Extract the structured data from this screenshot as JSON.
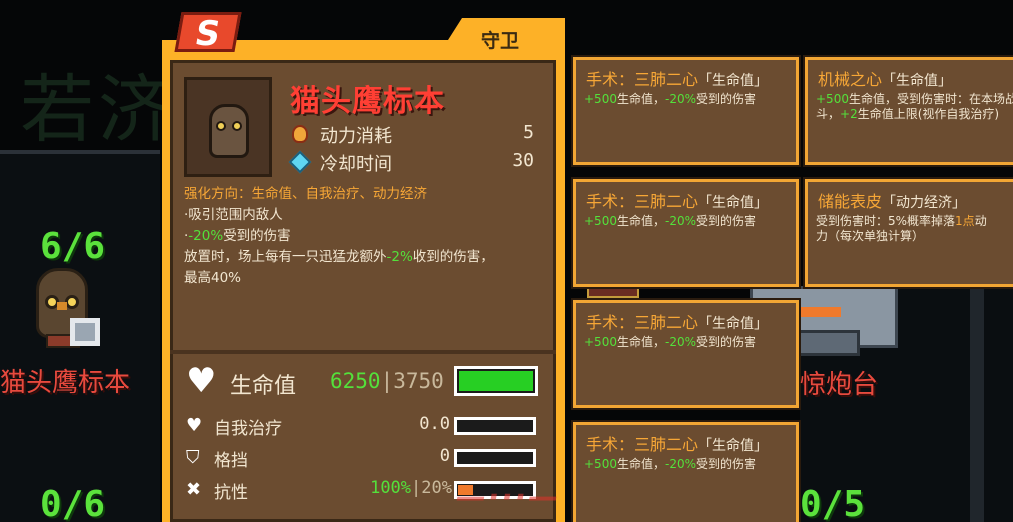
{
  "background": {
    "big_text": "若济",
    "left_top_count": "6/6",
    "left_bottom_count": "0/6",
    "right_bottom_count": "0/5",
    "left_unit_name": "猫头鹰标本",
    "right_unit_name": "惊炮台"
  },
  "card": {
    "tier_badge": "S",
    "role": "守卫",
    "title": "猫头鹰标本",
    "stats": [
      {
        "label": "动力消耗",
        "value": "5",
        "icon": "flame-icon"
      },
      {
        "label": "冷却时间",
        "value": "30",
        "icon": "crystal-icon"
      }
    ],
    "enhance_label": "强化方向：",
    "enhance_value": "生命值、自我治疗、动力经济",
    "bullet1": "·吸引范围内敌人",
    "bullet2_prefix": "·",
    "bullet2_num": "-20%",
    "bullet2_text": "受到的伤害",
    "deploy_text_a": "放置时，场上每有一只迅猛龙额外",
    "deploy_num": "-2%",
    "deploy_text_b": "收到的伤害，",
    "deploy_text_c": "最高40%",
    "life": {
      "label": "生命值",
      "current": "6250",
      "sep": "|",
      "base": "3750",
      "fill": 1.0
    },
    "self_heal": {
      "label": "自我治疗",
      "value": "0.0",
      "fill": 0.0
    },
    "block": {
      "label": "格挡",
      "value": "0",
      "fill": 0.0
    },
    "resist": {
      "label": "抗性",
      "value_a": "100%",
      "sep": "|",
      "value_b": "20%",
      "fill": 0.2
    }
  },
  "upgrades": [
    {
      "title": "手术：三肺二心",
      "tag": "「生命值」",
      "num1": "+500",
      "t1": "生命值，",
      "num2": "-20%",
      "t2": "受到的伤害"
    },
    {
      "title": "机械之心",
      "tag": "「生命值」",
      "num1": "+500",
      "t1": "生命值，受到伤害时：在本场战斗，",
      "num2": "+2",
      "t2": "生命值上限(视作自我治疗)"
    },
    {
      "title": "手术：三肺二心",
      "tag": "「生命值」",
      "num1": "+500",
      "t1": "生命值，",
      "num2": "-20%",
      "t2": "受到的伤害"
    },
    {
      "title": "储能表皮",
      "tag": "「动力经济」",
      "line1a": "受到伤害时：5%概率掉落",
      "line1b": "1点",
      "line1c": "动",
      "line2": "力（每次单独计算）"
    },
    {
      "title": "手术：三肺二心",
      "tag": "「生命值」",
      "num1": "+500",
      "t1": "生命值，",
      "num2": "-20%",
      "t2": "受到的伤害"
    },
    {
      "title": "手术：三肺二心",
      "tag": "「生命值」",
      "num1": "+500",
      "t1": "生命值，",
      "num2": "-20%",
      "t2": "受到的伤害"
    }
  ],
  "watermark": "—···—",
  "colors": {
    "accent": "#fdb127",
    "card_bg": "#6b4c30",
    "title_red": "#ff3f34",
    "green": "#54e03b",
    "orange": "#f7a736"
  }
}
